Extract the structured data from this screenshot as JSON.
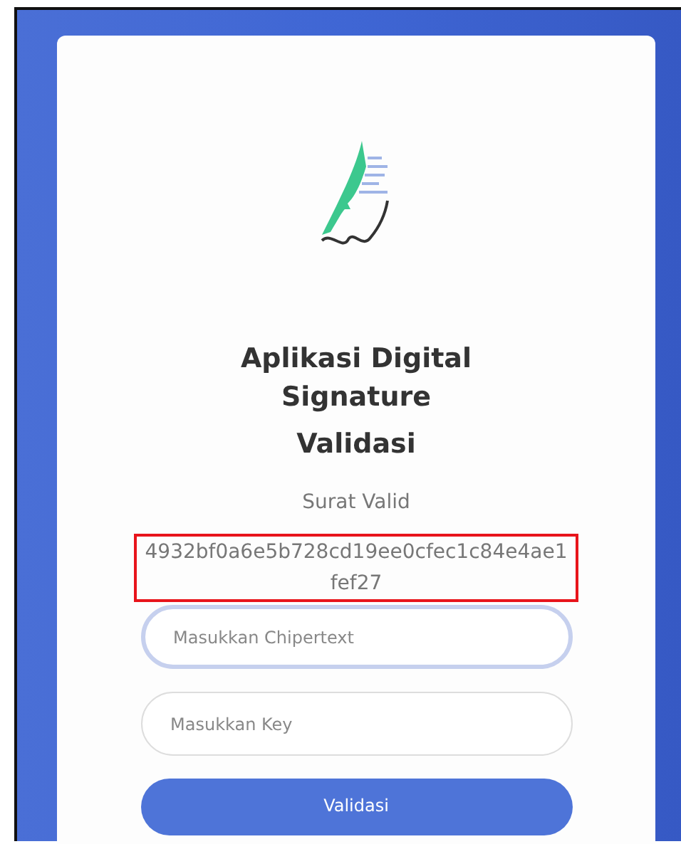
{
  "app": {
    "title": "Aplikasi Digital Signature",
    "subtitle": "Validasi"
  },
  "result": {
    "status": "Surat Valid",
    "hash": "4932bf0a6e5b728cd19ee0cfec1c84e4ae1fef27",
    "highlighted": true
  },
  "fields": [
    {
      "placeholder": "Masukkan Chipertext",
      "focused": true
    },
    {
      "placeholder": "Masukkan Key",
      "focused": false
    }
  ],
  "button": {
    "label": "Validasi"
  }
}
